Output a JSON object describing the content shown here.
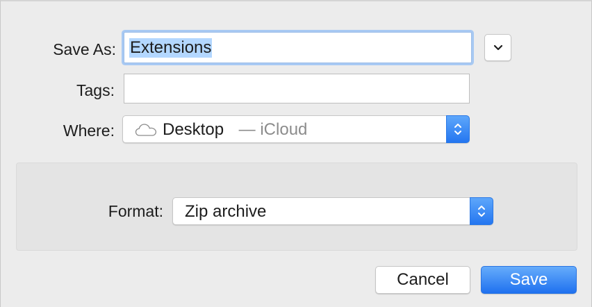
{
  "dialog": {
    "save_as": {
      "label": "Save As:",
      "value": "Extensions"
    },
    "tags": {
      "label": "Tags:",
      "value": ""
    },
    "where": {
      "label": "Where:",
      "location": "Desktop",
      "separator": " — ",
      "service": "iCloud"
    },
    "expand_icon": "chevron-down-icon",
    "cloud_icon": "cloud-icon"
  },
  "options": {
    "format": {
      "label": "Format:",
      "selected": "Zip archive"
    }
  },
  "buttons": {
    "cancel": "Cancel",
    "save": "Save"
  },
  "colors": {
    "accent": "#2476f0",
    "selection": "#b3d7ff",
    "focus_ring": "#a8c9f3"
  }
}
